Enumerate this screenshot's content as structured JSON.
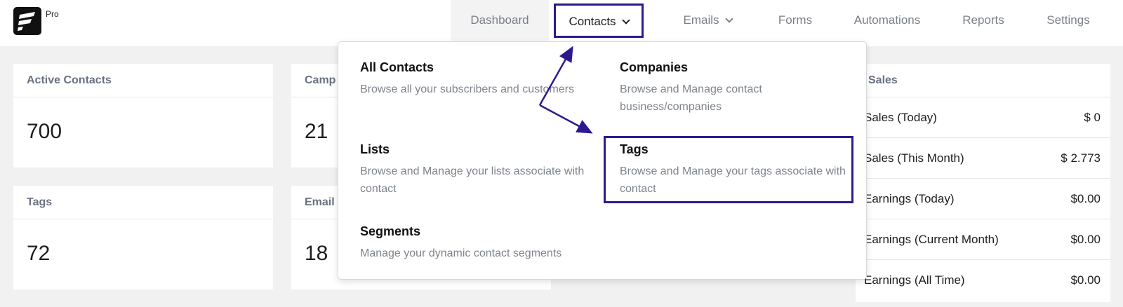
{
  "logo": {
    "icon": "fluentcrm-logo-icon",
    "badge": "Pro"
  },
  "nav": {
    "dashboard": "Dashboard",
    "contacts": "Contacts",
    "emails": "Emails",
    "forms": "Forms",
    "automations": "Automations",
    "reports": "Reports",
    "settings": "Settings"
  },
  "cards": {
    "active_contacts": {
      "label": "Active Contacts",
      "value": "700"
    },
    "campaigns": {
      "label": "Camp",
      "value": "21"
    },
    "tags": {
      "label": "Tags",
      "value": "72"
    },
    "email": {
      "label": "Email",
      "value": "18"
    }
  },
  "sales": {
    "label": "Sales",
    "rows": [
      {
        "label": "Sales (Today)",
        "value": "$ 0"
      },
      {
        "label": "Sales (This Month)",
        "value": "$ 2.773"
      },
      {
        "label": "Earnings (Today)",
        "value": "$0.00"
      },
      {
        "label": "Earnings (Current Month)",
        "value": "$0.00"
      },
      {
        "label": "Earnings (All Time)",
        "value": "$0.00"
      }
    ]
  },
  "dropdown": {
    "all_contacts": {
      "title": "All Contacts",
      "desc": "Browse all your subscribers and customers"
    },
    "companies": {
      "title": "Companies",
      "desc": "Browse and Manage contact business/companies"
    },
    "lists": {
      "title": "Lists",
      "desc": "Browse and Manage your lists associate with contact"
    },
    "tags": {
      "title": "Tags",
      "desc": "Browse and Manage your tags associate with contact"
    },
    "segments": {
      "title": "Segments",
      "desc": "Manage your dynamic contact segments"
    }
  },
  "colors": {
    "highlight": "#2e1a8e",
    "muted_text": "#7f848c",
    "background": "#f1f1f1"
  }
}
